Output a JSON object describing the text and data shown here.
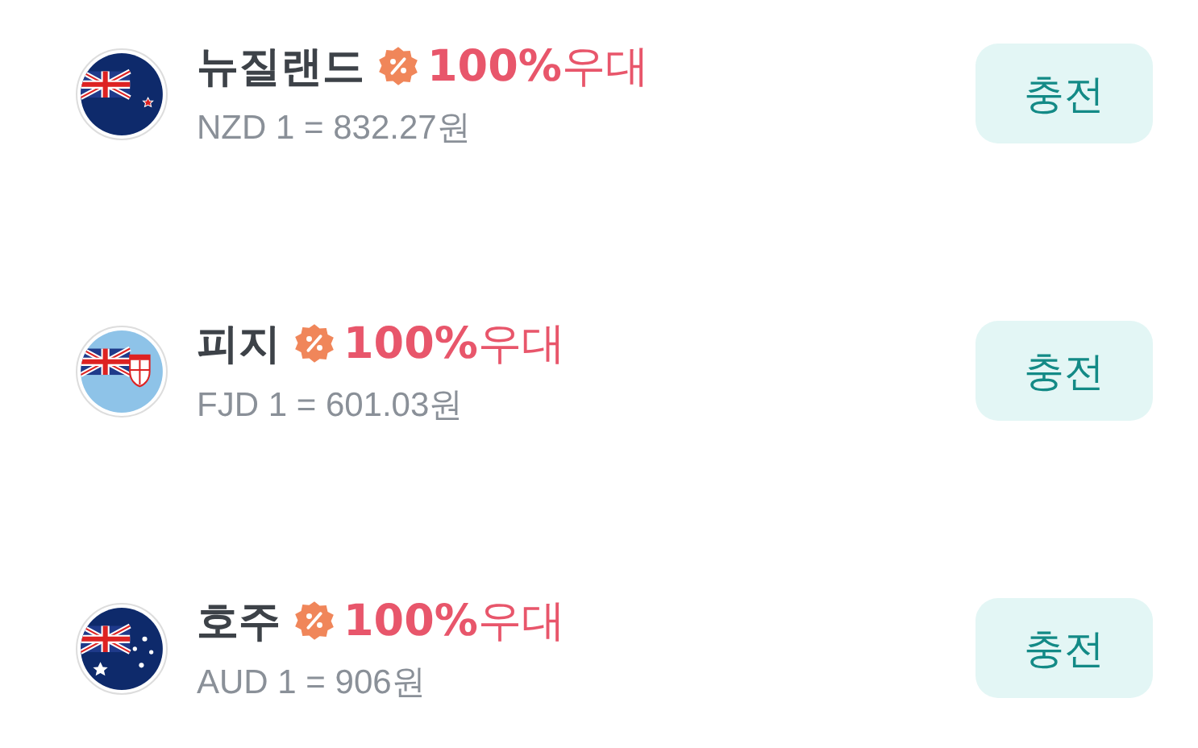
{
  "currencies": [
    {
      "kind": "nz",
      "name": "뉴질랜드",
      "benefit": "**100%**우대",
      "rate": "NZD 1 = 832.27원",
      "button": "충전"
    },
    {
      "kind": "fj",
      "name": "피지",
      "benefit": "**100%**우대",
      "rate": "FJD 1 = 601.03원",
      "button": "충전"
    },
    {
      "kind": "au",
      "name": "호주",
      "benefit": "**100%**우대",
      "rate": "AUD 1 = 906원",
      "button": "충전"
    }
  ]
}
